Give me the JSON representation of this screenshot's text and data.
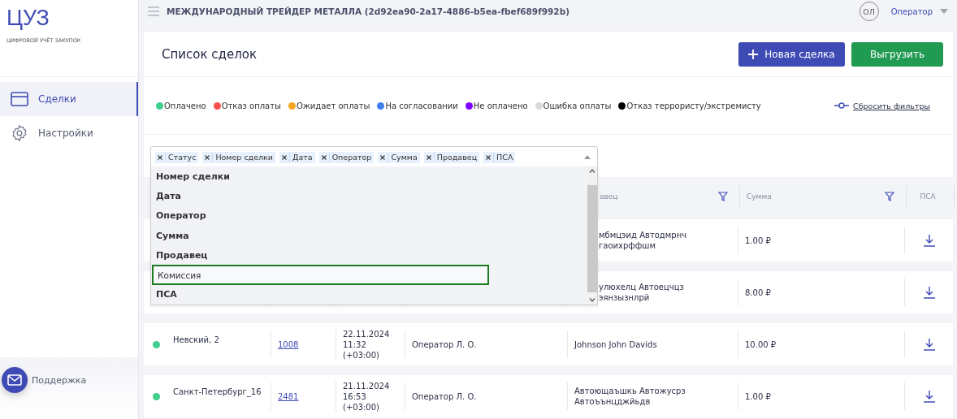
{
  "sidebar": {
    "logo": "ЦУЗ",
    "subtitle": "ЦИФРОВОЙ УЧЁТ ЗАКУПОК",
    "items": [
      {
        "label": "Сделки",
        "selected": true
      },
      {
        "label": "Настройки",
        "selected": false
      }
    ],
    "support": "Поддержка"
  },
  "topbar": {
    "title": "МЕЖДУНАРОДНЫЙ ТРЕЙДЕР МЕТАЛЛА (2d92ea90-2a17-4886-b5ea-fbef689f992b)",
    "avatar": "ОЛ",
    "user": "Оператор"
  },
  "page": {
    "title": "Список сделок",
    "buttons": [
      {
        "label": "Новая сделка",
        "kind": "primary"
      },
      {
        "label": "Выгрузить",
        "kind": "success"
      }
    ]
  },
  "legend": [
    {
      "label": "Оплачено",
      "color": "#3ecf8e"
    },
    {
      "label": "Отказ оплаты",
      "color": "#f5504e"
    },
    {
      "label": "Ожидает оплаты",
      "color": "#f5a623"
    },
    {
      "label": "На согласовании",
      "color": "#3d7ef0"
    },
    {
      "label": "Не оплачено",
      "color": "#8000ff"
    },
    {
      "label": "Ошибка оплаты",
      "color": "#d8d8d8"
    },
    {
      "label": "Отказ террористу/экстремисту",
      "color": "#000000"
    }
  ],
  "reset_filters": "Сбросить фильтры",
  "column_picker": {
    "tags": [
      "Статус",
      "Номер сделки",
      "Дата",
      "Оператор",
      "Сумма",
      "Продавец",
      "ПСА"
    ],
    "options": [
      {
        "label": "Номер сделки",
        "selected": true,
        "focused": false
      },
      {
        "label": "Дата",
        "selected": true,
        "focused": false
      },
      {
        "label": "Оператор",
        "selected": true,
        "focused": false
      },
      {
        "label": "Сумма",
        "selected": true,
        "focused": false
      },
      {
        "label": "Продавец",
        "selected": true,
        "focused": false
      },
      {
        "label": "Комиссия",
        "selected": false,
        "focused": true
      },
      {
        "label": "ПСА",
        "selected": true,
        "focused": false
      }
    ]
  },
  "table": {
    "columns": [
      {
        "label": "авец",
        "filter": true
      },
      {
        "label": "Сумма",
        "filter": true
      },
      {
        "label": "ПСА",
        "filter": false
      }
    ],
    "rows": [
      {
        "seller": [
          "мбмцэид Автодмрнч",
          "гаоихрффшм"
        ],
        "sum": "1.00 ₽"
      },
      {
        "seller": [
          "улюхелц Автоецчцз",
          "эянзызнлрй"
        ],
        "sum": "8.00 ₽"
      },
      {
        "color": "#3ecf8e",
        "name": "Невский, 2",
        "number": "1008",
        "date": [
          "22.11.2024",
          "11:32",
          "(+03:00)"
        ],
        "operator": "Оператор Л. О.",
        "seller": [
          "Johnson John Davids"
        ],
        "sum": "10.00 ₽"
      },
      {
        "color": "#3ecf8e",
        "name": "Санкт-Петербург_16",
        "number": "2481",
        "date": [
          "21.11.2024",
          "16:53",
          "(+03:00)"
        ],
        "operator": "Оператор Л. О.",
        "seller": [
          "Автоющаъшкь Автожусрз",
          "Автоъънцджйьдв"
        ],
        "sum": "1.00 ₽"
      }
    ]
  }
}
